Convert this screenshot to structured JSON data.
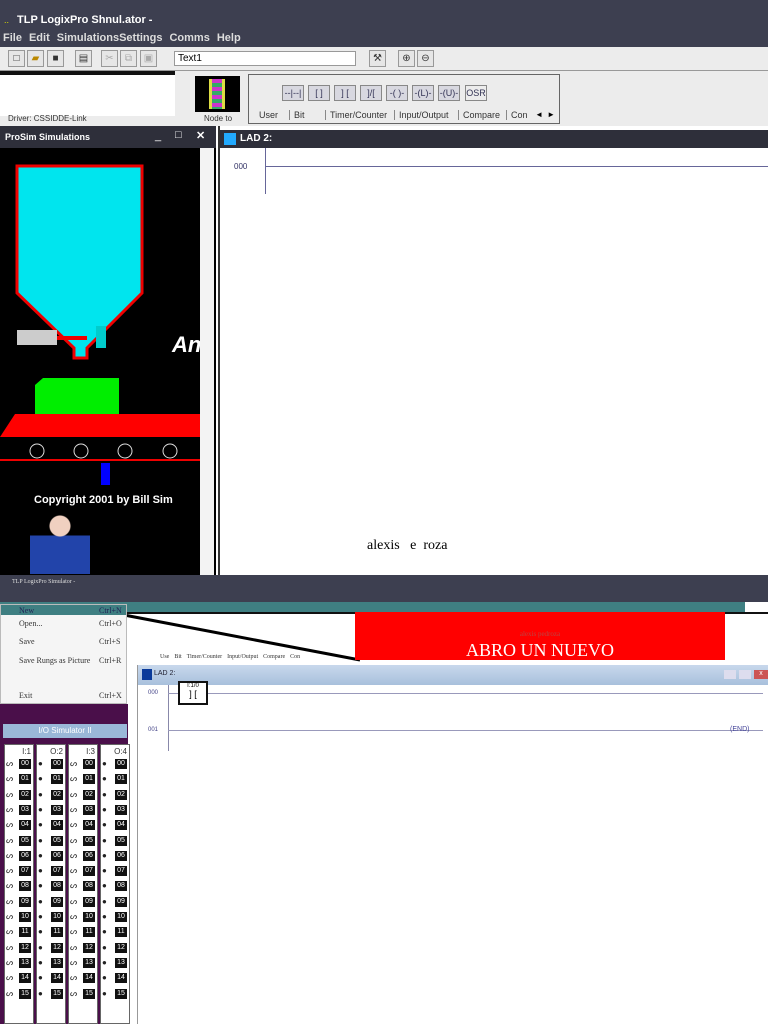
{
  "top": {
    "title": "TLP LogixPro  Shnul.ator -",
    "menu": [
      "File",
      "Edit",
      "SimulationsSettings",
      "Comms",
      "Help"
    ],
    "toolbar_field": "Text1",
    "driver": "Driver: CSSIDDE-Link",
    "node": "Node to",
    "instructions": [
      "--|--|",
      "[ ]",
      "] [",
      "]/[",
      "-( )-",
      "-(L)-",
      "-(U)-",
      "OSR"
    ],
    "tabs": [
      "User",
      "Bit",
      "Timer/Counter",
      "Input/Output",
      "Compare",
      "Con"
    ],
    "prosim_title": "ProSim Simulations",
    "sim_text_partial": "An",
    "copyright": "Copyright 2001 by Bill Sim",
    "lad_title": "LAD 2:",
    "rung": "000",
    "caption": "alexis   e  roza"
  },
  "bottom": {
    "title": "TLP LogixPro Simulator -",
    "file_menu": [
      {
        "label": "New",
        "shortcut": "Ctrl+N"
      },
      {
        "label": "Open...",
        "shortcut": "Ctrl+O"
      },
      {
        "label": "Save",
        "shortcut": "Ctrl+S"
      },
      {
        "label": "Save Rungs as Picture",
        "shortcut": "Ctrl+R"
      },
      {
        "label": "Exit",
        "shortcut": "Ctrl+X"
      }
    ],
    "tabs": [
      "Use",
      "Bit",
      "Timer/Counter",
      "Input/Output",
      "Compare",
      "Con"
    ],
    "banner_small": "alexis pedroza",
    "banner_big": "ABRO UN NUEVO",
    "lad_title": "LAD 2:",
    "rungs": [
      "000",
      "001"
    ],
    "contact_addr": "I:1/0",
    "end_label": "END",
    "io_title": "I/O Simulator II",
    "io_columns": [
      "I:1",
      "O:2",
      "I:3",
      "O:4"
    ],
    "io_rows": [
      "00",
      "01",
      "02",
      "03",
      "04",
      "05",
      "06",
      "07",
      "08",
      "09",
      "10",
      "11",
      "12",
      "13",
      "14",
      "15"
    ]
  },
  "colors": {
    "banner": "#ff0000",
    "hopper": "#00e5ee",
    "box": "#00ee00",
    "belt": "#ff0000",
    "io_bg": "#4a0f4a"
  }
}
